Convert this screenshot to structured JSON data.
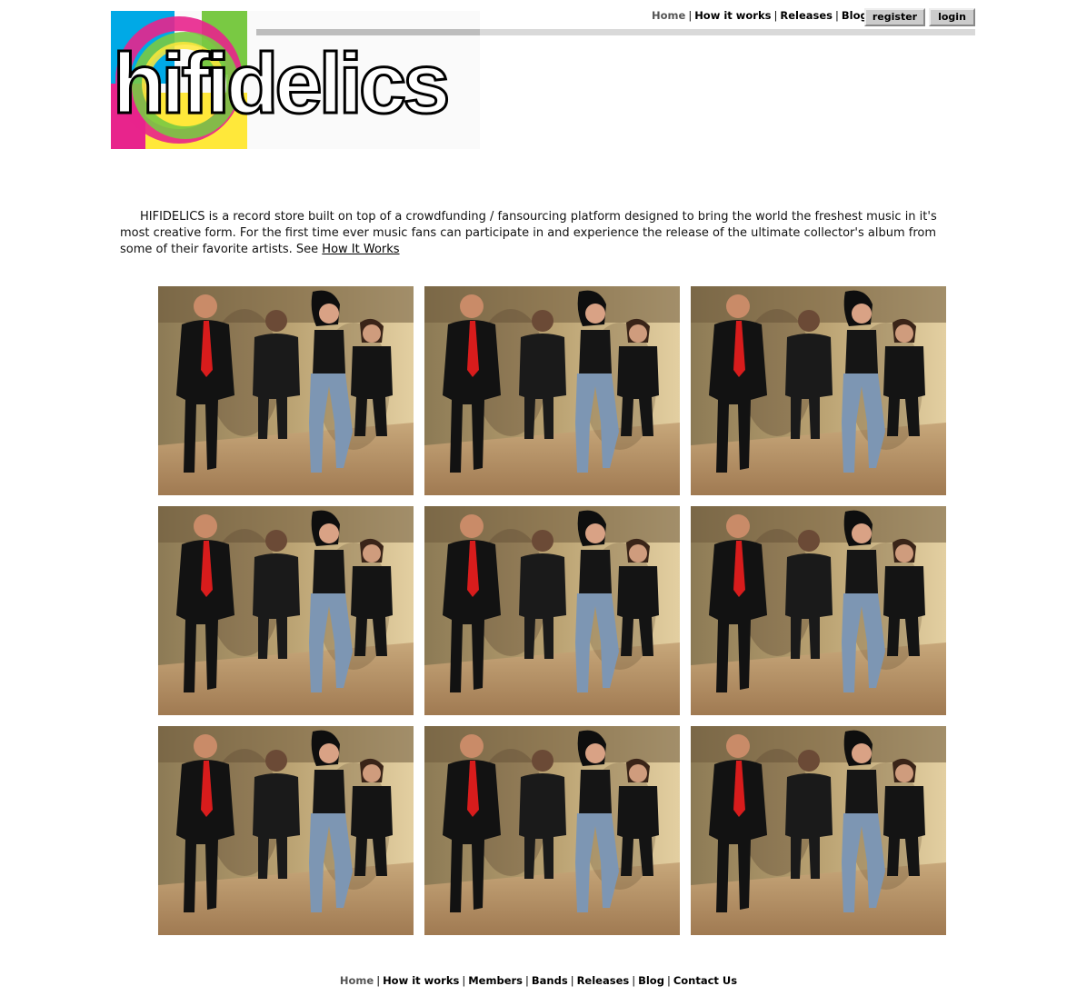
{
  "logo": {
    "text": "hifidelics"
  },
  "top_nav": {
    "items": [
      {
        "label": "Home",
        "current": true
      },
      {
        "label": "How it works"
      },
      {
        "label": "Releases"
      },
      {
        "label": "Blog"
      }
    ],
    "separator": "|"
  },
  "auth": {
    "register_label": "register",
    "login_label": "login"
  },
  "intro": {
    "text": "HIFIDELICS is a record store built on top of a crowdfunding / fansourcing platform designed to bring the world the freshest music in it's most creative form. For the first time ever music fans can participate in and experience the release of the ultimate collector's album from some of their favorite artists. See ",
    "link_label": "How It Works"
  },
  "gallery": {
    "count": 9,
    "image_description": "band-photo"
  },
  "bottom_nav": {
    "items": [
      {
        "label": "Home",
        "current": true
      },
      {
        "label": "How it works"
      },
      {
        "label": "Members"
      },
      {
        "label": "Bands"
      },
      {
        "label": "Releases"
      },
      {
        "label": "Blog"
      },
      {
        "label": "Contact Us"
      }
    ]
  },
  "colors": {
    "logo_cyan": "#00a9e6",
    "logo_magenta": "#e8248c",
    "logo_yellow": "#ffe83a",
    "logo_green": "#79c943",
    "bar_dark": "#bdbdbd",
    "bar_light": "#d9d9d9",
    "nav_current": "#555555"
  }
}
